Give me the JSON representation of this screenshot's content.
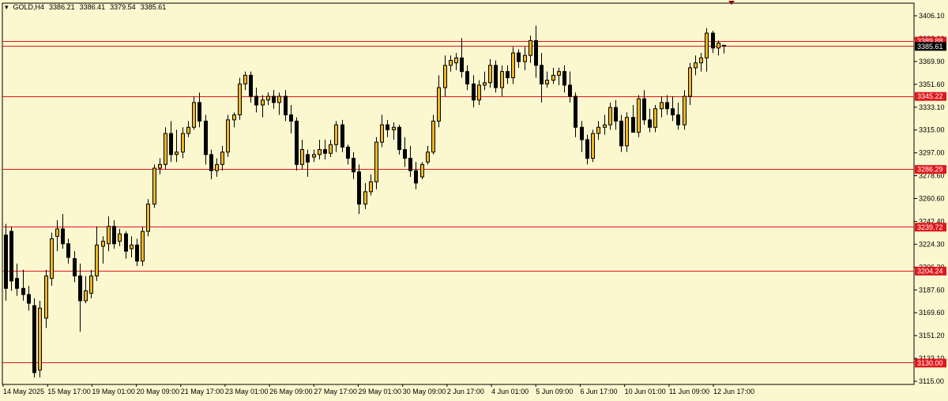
{
  "header": {
    "symbol_tf": "GOLD,H4",
    "ohlc": [
      "3386.21",
      "3386.41",
      "3379.54",
      "3385.61"
    ]
  },
  "colors": {
    "background": "#fbf7cf",
    "bull_candle": "#f0b627",
    "bear_candle": "#000000",
    "level_line": "#e0161b",
    "price_line": "#000000",
    "level_label_bg": "#e0161b",
    "current_label_bg": "#000000"
  },
  "chart_data": {
    "type": "candlestick",
    "ylim": [
      3115.0,
      3410.0
    ],
    "y_ticks": [
      "3406.10",
      "3388.00",
      "3369.90",
      "3351.60",
      "3333.10",
      "3315.00",
      "3297.00",
      "3278.60",
      "3260.60",
      "3242.40",
      "3224.30",
      "3206.20",
      "3187.60",
      "3169.60",
      "3151.20",
      "3133.10",
      "3115.00"
    ],
    "x_labels": [
      "14 May 2025",
      "15 May 17:00",
      "19 May 01:00",
      "20 May 09:00",
      "21 May 17:00",
      "23 May 01:00",
      "26 May 09:00",
      "27 May 17:00",
      "29 May 01:00",
      "30 May 09:00",
      "2 Jun 17:00",
      "4 Jun 01:00",
      "5 Jun 09:00",
      "6 Jun 17:00",
      "10 Jun 01:00",
      "11 Jun 09:00",
      "12 Jun 17:00"
    ],
    "levels": [
      {
        "value": 3389.88,
        "label": "3389.88"
      },
      {
        "value": 3345.22,
        "label": "3345.22"
      },
      {
        "value": 3286.29,
        "label": "3286.29"
      },
      {
        "value": 3239.72,
        "label": "3239.72"
      },
      {
        "value": 3204.24,
        "label": "3204.24"
      },
      {
        "value": 3130.0,
        "label": "3130.00"
      }
    ],
    "current_price": {
      "value": 3385.61,
      "label": "3385.61"
    },
    "candles": [
      {
        "o": 3233,
        "h": 3242,
        "l": 3180,
        "c": 3190
      },
      {
        "o": 3236,
        "h": 3240,
        "l": 3188,
        "c": 3196
      },
      {
        "o": 3198,
        "h": 3210,
        "l": 3184,
        "c": 3190
      },
      {
        "o": 3190,
        "h": 3205,
        "l": 3180,
        "c": 3185
      },
      {
        "o": 3185,
        "h": 3192,
        "l": 3172,
        "c": 3178
      },
      {
        "o": 3176,
        "h": 3182,
        "l": 3118,
        "c": 3122
      },
      {
        "o": 3124,
        "h": 3180,
        "l": 3118,
        "c": 3174
      },
      {
        "o": 3166,
        "h": 3205,
        "l": 3158,
        "c": 3200
      },
      {
        "o": 3198,
        "h": 3235,
        "l": 3192,
        "c": 3230
      },
      {
        "o": 3232,
        "h": 3245,
        "l": 3220,
        "c": 3238
      },
      {
        "o": 3238,
        "h": 3250,
        "l": 3222,
        "c": 3226
      },
      {
        "o": 3226,
        "h": 3230,
        "l": 3210,
        "c": 3215
      },
      {
        "o": 3214,
        "h": 3220,
        "l": 3195,
        "c": 3200
      },
      {
        "o": 3200,
        "h": 3210,
        "l": 3155,
        "c": 3180
      },
      {
        "o": 3180,
        "h": 3200,
        "l": 3178,
        "c": 3188
      },
      {
        "o": 3186,
        "h": 3205,
        "l": 3182,
        "c": 3200
      },
      {
        "o": 3200,
        "h": 3240,
        "l": 3196,
        "c": 3225
      },
      {
        "o": 3224,
        "h": 3232,
        "l": 3210,
        "c": 3228
      },
      {
        "o": 3226,
        "h": 3248,
        "l": 3220,
        "c": 3240
      },
      {
        "o": 3240,
        "h": 3245,
        "l": 3222,
        "c": 3226
      },
      {
        "o": 3228,
        "h": 3238,
        "l": 3224,
        "c": 3234
      },
      {
        "o": 3234,
        "h": 3236,
        "l": 3214,
        "c": 3220
      },
      {
        "o": 3222,
        "h": 3232,
        "l": 3215,
        "c": 3225
      },
      {
        "o": 3225,
        "h": 3230,
        "l": 3208,
        "c": 3212
      },
      {
        "o": 3212,
        "h": 3240,
        "l": 3208,
        "c": 3236
      },
      {
        "o": 3236,
        "h": 3262,
        "l": 3232,
        "c": 3258
      },
      {
        "o": 3258,
        "h": 3290,
        "l": 3255,
        "c": 3287
      },
      {
        "o": 3287,
        "h": 3295,
        "l": 3282,
        "c": 3290
      },
      {
        "o": 3290,
        "h": 3320,
        "l": 3286,
        "c": 3315
      },
      {
        "o": 3315,
        "h": 3325,
        "l": 3292,
        "c": 3298
      },
      {
        "o": 3298,
        "h": 3318,
        "l": 3292,
        "c": 3300
      },
      {
        "o": 3300,
        "h": 3320,
        "l": 3295,
        "c": 3315
      },
      {
        "o": 3315,
        "h": 3325,
        "l": 3312,
        "c": 3320
      },
      {
        "o": 3320,
        "h": 3345,
        "l": 3318,
        "c": 3340
      },
      {
        "o": 3340,
        "h": 3348,
        "l": 3320,
        "c": 3325
      },
      {
        "o": 3325,
        "h": 3330,
        "l": 3290,
        "c": 3298
      },
      {
        "o": 3298,
        "h": 3302,
        "l": 3278,
        "c": 3285
      },
      {
        "o": 3285,
        "h": 3295,
        "l": 3280,
        "c": 3290
      },
      {
        "o": 3290,
        "h": 3305,
        "l": 3285,
        "c": 3300
      },
      {
        "o": 3300,
        "h": 3330,
        "l": 3296,
        "c": 3326
      },
      {
        "o": 3326,
        "h": 3332,
        "l": 3320,
        "c": 3330
      },
      {
        "o": 3330,
        "h": 3360,
        "l": 3326,
        "c": 3355
      },
      {
        "o": 3355,
        "h": 3365,
        "l": 3350,
        "c": 3362
      },
      {
        "o": 3362,
        "h": 3365,
        "l": 3340,
        "c": 3345
      },
      {
        "o": 3345,
        "h": 3352,
        "l": 3332,
        "c": 3338
      },
      {
        "o": 3338,
        "h": 3346,
        "l": 3328,
        "c": 3342
      },
      {
        "o": 3342,
        "h": 3348,
        "l": 3338,
        "c": 3345
      },
      {
        "o": 3345,
        "h": 3350,
        "l": 3335,
        "c": 3340
      },
      {
        "o": 3340,
        "h": 3348,
        "l": 3330,
        "c": 3345
      },
      {
        "o": 3345,
        "h": 3350,
        "l": 3325,
        "c": 3330
      },
      {
        "o": 3330,
        "h": 3338,
        "l": 3315,
        "c": 3325
      },
      {
        "o": 3325,
        "h": 3328,
        "l": 3285,
        "c": 3290
      },
      {
        "o": 3290,
        "h": 3310,
        "l": 3286,
        "c": 3302
      },
      {
        "o": 3298,
        "h": 3302,
        "l": 3280,
        "c": 3292
      },
      {
        "o": 3296,
        "h": 3302,
        "l": 3292,
        "c": 3298
      },
      {
        "o": 3298,
        "h": 3310,
        "l": 3294,
        "c": 3302
      },
      {
        "o": 3302,
        "h": 3310,
        "l": 3294,
        "c": 3299
      },
      {
        "o": 3299,
        "h": 3310,
        "l": 3296,
        "c": 3306
      },
      {
        "o": 3306,
        "h": 3325,
        "l": 3300,
        "c": 3322
      },
      {
        "o": 3322,
        "h": 3326,
        "l": 3300,
        "c": 3304
      },
      {
        "o": 3304,
        "h": 3306,
        "l": 3290,
        "c": 3295
      },
      {
        "o": 3295,
        "h": 3300,
        "l": 3278,
        "c": 3284
      },
      {
        "o": 3284,
        "h": 3290,
        "l": 3250,
        "c": 3258
      },
      {
        "o": 3258,
        "h": 3275,
        "l": 3254,
        "c": 3268
      },
      {
        "o": 3268,
        "h": 3282,
        "l": 3265,
        "c": 3276
      },
      {
        "o": 3276,
        "h": 3312,
        "l": 3270,
        "c": 3308
      },
      {
        "o": 3308,
        "h": 3330,
        "l": 3304,
        "c": 3322
      },
      {
        "o": 3322,
        "h": 3326,
        "l": 3312,
        "c": 3318
      },
      {
        "o": 3318,
        "h": 3324,
        "l": 3310,
        "c": 3320
      },
      {
        "o": 3320,
        "h": 3322,
        "l": 3298,
        "c": 3302
      },
      {
        "o": 3302,
        "h": 3312,
        "l": 3288,
        "c": 3295
      },
      {
        "o": 3295,
        "h": 3305,
        "l": 3280,
        "c": 3285
      },
      {
        "o": 3285,
        "h": 3292,
        "l": 3270,
        "c": 3275
      },
      {
        "o": 3280,
        "h": 3292,
        "l": 3278,
        "c": 3290
      },
      {
        "o": 3292,
        "h": 3305,
        "l": 3290,
        "c": 3300
      },
      {
        "o": 3300,
        "h": 3330,
        "l": 3298,
        "c": 3325
      },
      {
        "o": 3325,
        "h": 3362,
        "l": 3320,
        "c": 3352
      },
      {
        "o": 3352,
        "h": 3378,
        "l": 3345,
        "c": 3370
      },
      {
        "o": 3370,
        "h": 3378,
        "l": 3365,
        "c": 3374
      },
      {
        "o": 3372,
        "h": 3380,
        "l": 3366,
        "c": 3376
      },
      {
        "o": 3376,
        "h": 3392,
        "l": 3360,
        "c": 3365
      },
      {
        "o": 3365,
        "h": 3370,
        "l": 3350,
        "c": 3355
      },
      {
        "o": 3355,
        "h": 3362,
        "l": 3336,
        "c": 3342
      },
      {
        "o": 3342,
        "h": 3358,
        "l": 3338,
        "c": 3354
      },
      {
        "o": 3354,
        "h": 3365,
        "l": 3350,
        "c": 3356
      },
      {
        "o": 3356,
        "h": 3375,
        "l": 3352,
        "c": 3370
      },
      {
        "o": 3370,
        "h": 3374,
        "l": 3348,
        "c": 3352
      },
      {
        "o": 3352,
        "h": 3370,
        "l": 3345,
        "c": 3365
      },
      {
        "o": 3365,
        "h": 3370,
        "l": 3355,
        "c": 3360
      },
      {
        "o": 3360,
        "h": 3385,
        "l": 3355,
        "c": 3380
      },
      {
        "o": 3380,
        "h": 3383,
        "l": 3368,
        "c": 3373
      },
      {
        "o": 3373,
        "h": 3385,
        "l": 3366,
        "c": 3378
      },
      {
        "o": 3378,
        "h": 3394,
        "l": 3372,
        "c": 3390
      },
      {
        "o": 3390,
        "h": 3402,
        "l": 3360,
        "c": 3370
      },
      {
        "o": 3370,
        "h": 3380,
        "l": 3340,
        "c": 3355
      },
      {
        "o": 3355,
        "h": 3365,
        "l": 3352,
        "c": 3358
      },
      {
        "o": 3358,
        "h": 3368,
        "l": 3355,
        "c": 3362
      },
      {
        "o": 3362,
        "h": 3368,
        "l": 3354,
        "c": 3365
      },
      {
        "o": 3365,
        "h": 3370,
        "l": 3348,
        "c": 3354
      },
      {
        "o": 3354,
        "h": 3365,
        "l": 3340,
        "c": 3345
      },
      {
        "o": 3345,
        "h": 3348,
        "l": 3312,
        "c": 3320
      },
      {
        "o": 3320,
        "h": 3325,
        "l": 3300,
        "c": 3310
      },
      {
        "o": 3310,
        "h": 3314,
        "l": 3290,
        "c": 3295
      },
      {
        "o": 3295,
        "h": 3318,
        "l": 3292,
        "c": 3315
      },
      {
        "o": 3315,
        "h": 3325,
        "l": 3310,
        "c": 3320
      },
      {
        "o": 3320,
        "h": 3330,
        "l": 3314,
        "c": 3322
      },
      {
        "o": 3322,
        "h": 3340,
        "l": 3318,
        "c": 3336
      },
      {
        "o": 3336,
        "h": 3342,
        "l": 3318,
        "c": 3325
      },
      {
        "o": 3325,
        "h": 3330,
        "l": 3300,
        "c": 3305
      },
      {
        "o": 3305,
        "h": 3332,
        "l": 3300,
        "c": 3328
      },
      {
        "o": 3328,
        "h": 3338,
        "l": 3320,
        "c": 3316
      },
      {
        "o": 3316,
        "h": 3346,
        "l": 3312,
        "c": 3343
      },
      {
        "o": 3343,
        "h": 3350,
        "l": 3322,
        "c": 3326
      },
      {
        "o": 3326,
        "h": 3335,
        "l": 3316,
        "c": 3320
      },
      {
        "o": 3320,
        "h": 3338,
        "l": 3316,
        "c": 3335
      },
      {
        "o": 3335,
        "h": 3345,
        "l": 3328,
        "c": 3340
      },
      {
        "o": 3340,
        "h": 3346,
        "l": 3330,
        "c": 3335
      },
      {
        "o": 3335,
        "h": 3345,
        "l": 3325,
        "c": 3330
      },
      {
        "o": 3330,
        "h": 3340,
        "l": 3318,
        "c": 3322
      },
      {
        "o": 3322,
        "h": 3350,
        "l": 3318,
        "c": 3345
      },
      {
        "o": 3345,
        "h": 3372,
        "l": 3338,
        "c": 3368
      },
      {
        "o": 3368,
        "h": 3378,
        "l": 3362,
        "c": 3372
      },
      {
        "o": 3372,
        "h": 3380,
        "l": 3365,
        "c": 3376
      },
      {
        "o": 3376,
        "h": 3400,
        "l": 3365,
        "c": 3396
      },
      {
        "o": 3396,
        "h": 3398,
        "l": 3380,
        "c": 3384
      },
      {
        "o": 3384,
        "h": 3390,
        "l": 3378,
        "c": 3388
      },
      {
        "o": 3386.21,
        "h": 3386.41,
        "l": 3379.54,
        "c": 3385.61
      }
    ]
  }
}
